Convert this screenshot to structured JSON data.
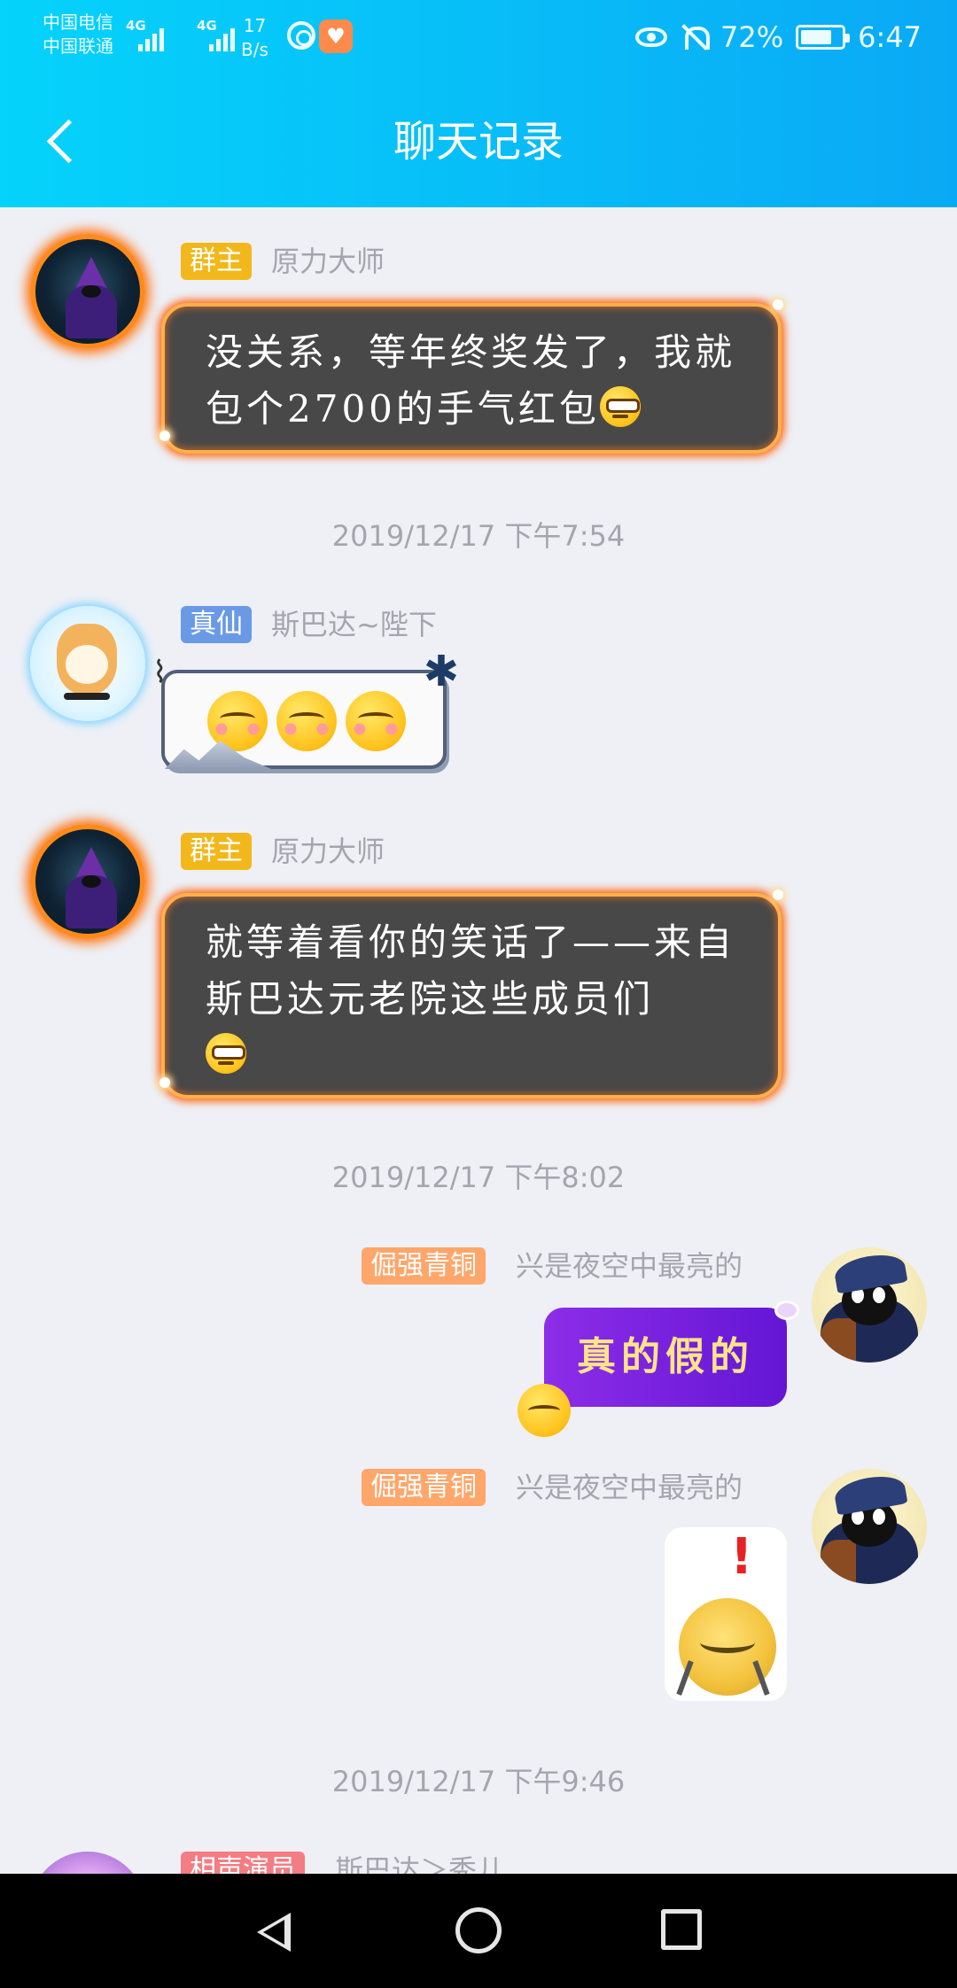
{
  "status_bar": {
    "carrier_1": "中国电信",
    "carrier_2": "中国联通",
    "net_1": "4G",
    "net_2": "4G",
    "speed_value": "17",
    "speed_unit": "B/s",
    "battery_percent": "72%",
    "time": "6:47"
  },
  "header": {
    "title": "聊天记录",
    "back_icon": "chevron-left-icon"
  },
  "messages": [
    {
      "badge": "群主",
      "nickname": "原力大师",
      "text": "没关系，等年终奖发了，我就包个2700的手气红包"
    },
    {
      "timestamp": "2019/12/17 下午7:54"
    },
    {
      "badge": "真仙",
      "nickname": "斯巴达~陛下"
    },
    {
      "badge": "群主",
      "nickname": "原力大师",
      "text": "就等着看你的笑话了——来自斯巴达元老院这些成员们"
    },
    {
      "timestamp": "2019/12/17 下午8:02"
    },
    {
      "badge": "倔强青铜",
      "nickname": "兴是夜空中最亮的",
      "text": "真的假的"
    },
    {
      "badge": "倔强青铜",
      "nickname": "兴是夜空中最亮的"
    },
    {
      "timestamp": "2019/12/17 下午9:46"
    },
    {
      "badge": "相声演员",
      "nickname": "斯巴达＞秀儿"
    }
  ],
  "nav_bar": {
    "icons": [
      "back-triangle-icon",
      "home-circle-icon",
      "recents-square-icon"
    ]
  },
  "colors": {
    "header_start": "#05d3fb",
    "header_end": "#0aa9f5",
    "badge_owner": "#f2b81b",
    "badge_xian": "#6a9ae6",
    "badge_bronze": "#ffa66b",
    "badge_performer": "#f47c83"
  }
}
